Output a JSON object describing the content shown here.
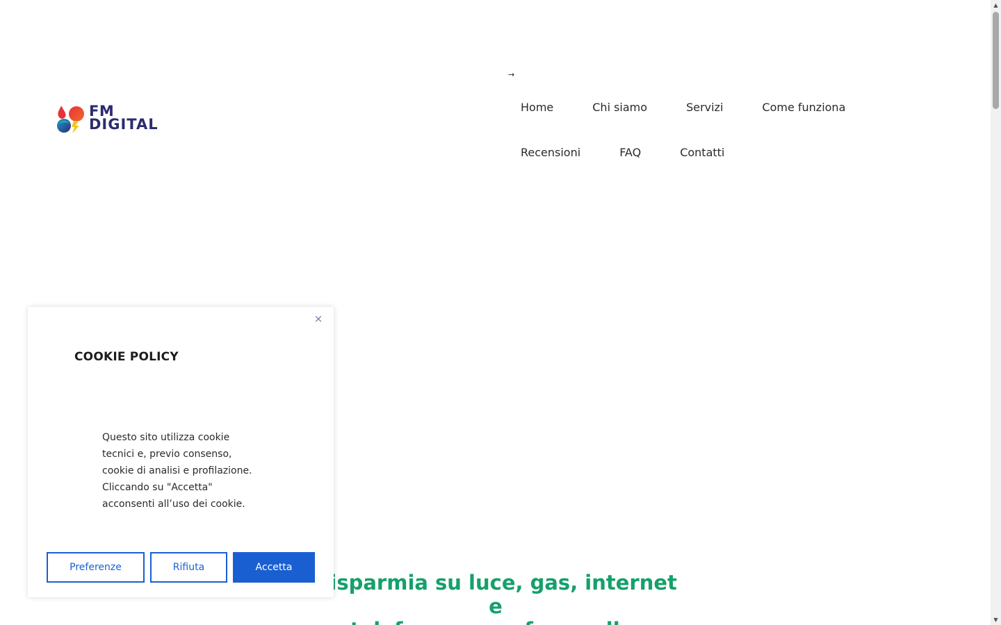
{
  "logo": {
    "line1": "FM",
    "line2": "DIGITAL"
  },
  "nav": {
    "arrow": "→",
    "row1": [
      "Home",
      "Chi siamo",
      "Servizi",
      "Come funziona"
    ],
    "row2": [
      "Recensioni",
      "FAQ",
      "Contatti"
    ]
  },
  "hero": {
    "line1": "Risparmia su luce, gas, internet e",
    "line2": "telefono senza fare nulla."
  },
  "cookie": {
    "close": "×",
    "title": "COOKIE POLICY",
    "text": "Questo sito utilizza cookie tecnici e, previo consenso, cookie di analisi e profilazione. Cliccando su \"Accetta\" acconsenti all’uso dei cookie.",
    "preferences_label": "Preferenze",
    "reject_label": "Rifiuta",
    "accept_label": "Accetta"
  },
  "scrollbar": {
    "up": "▲",
    "down": "▼"
  },
  "colors": {
    "accent_blue": "#1a5fd1",
    "hero_green": "#16a06a",
    "logo_navy": "#2b2c6f"
  },
  "icons": {
    "logo": "fm-digital-logo-icon",
    "close": "close-icon",
    "arrow": "arrow-right-icon"
  }
}
